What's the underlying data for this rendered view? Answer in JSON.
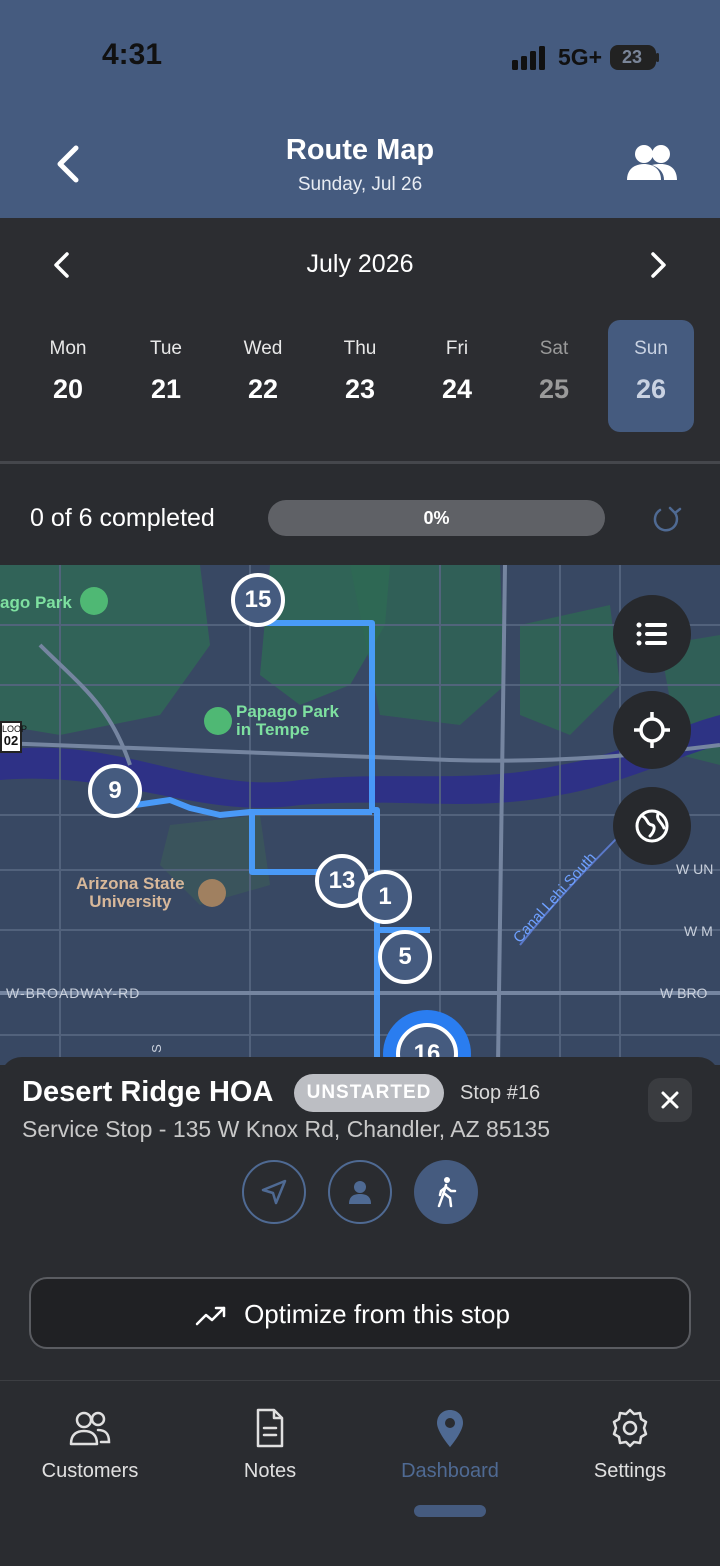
{
  "status": {
    "time": "4:31",
    "network": "5G+",
    "battery": "23"
  },
  "header": {
    "title": "Route Map",
    "subtitle": "Sunday, Jul 26"
  },
  "calendar": {
    "month": "July 2026",
    "days": [
      {
        "dow": "Mon",
        "num": "20"
      },
      {
        "dow": "Tue",
        "num": "21"
      },
      {
        "dow": "Wed",
        "num": "22"
      },
      {
        "dow": "Thu",
        "num": "23"
      },
      {
        "dow": "Fri",
        "num": "24"
      },
      {
        "dow": "Sat",
        "num": "25"
      },
      {
        "dow": "Sun",
        "num": "26"
      }
    ],
    "selected_index": 6
  },
  "progress": {
    "completed_text": "0 of 6 completed",
    "percent": 0,
    "label": "0%"
  },
  "map": {
    "labels": {
      "park_left": "ago Park",
      "park_center_1": "Papago Park",
      "park_center_2": "in Tempe",
      "univ_1": "Arizona State",
      "univ_2": "University",
      "road_broadway": "W-BROADWAY-RD",
      "road_canal": "Canal Lehi South",
      "road_wun": "W UN",
      "road_wm": "W M",
      "road_wbro": "W BRO",
      "loop_top": "LOOP",
      "loop_num": "02",
      "road_s": "S"
    },
    "markers": [
      "15",
      "9",
      "13",
      "1",
      "5",
      "16"
    ]
  },
  "stop": {
    "name": "Desert Ridge HOA",
    "status": "UNSTARTED",
    "stop_number": "Stop #16",
    "address": "Service Stop - 135 W Knox Rd, Chandler, AZ 85135",
    "optimize_label": "Optimize from this stop"
  },
  "tabs": [
    {
      "label": "Customers"
    },
    {
      "label": "Notes"
    },
    {
      "label": "Dashboard"
    },
    {
      "label": "Settings"
    }
  ],
  "colors": {
    "header": "#455b7f",
    "route": "#4a9eff",
    "accent": "#4f6a93"
  }
}
